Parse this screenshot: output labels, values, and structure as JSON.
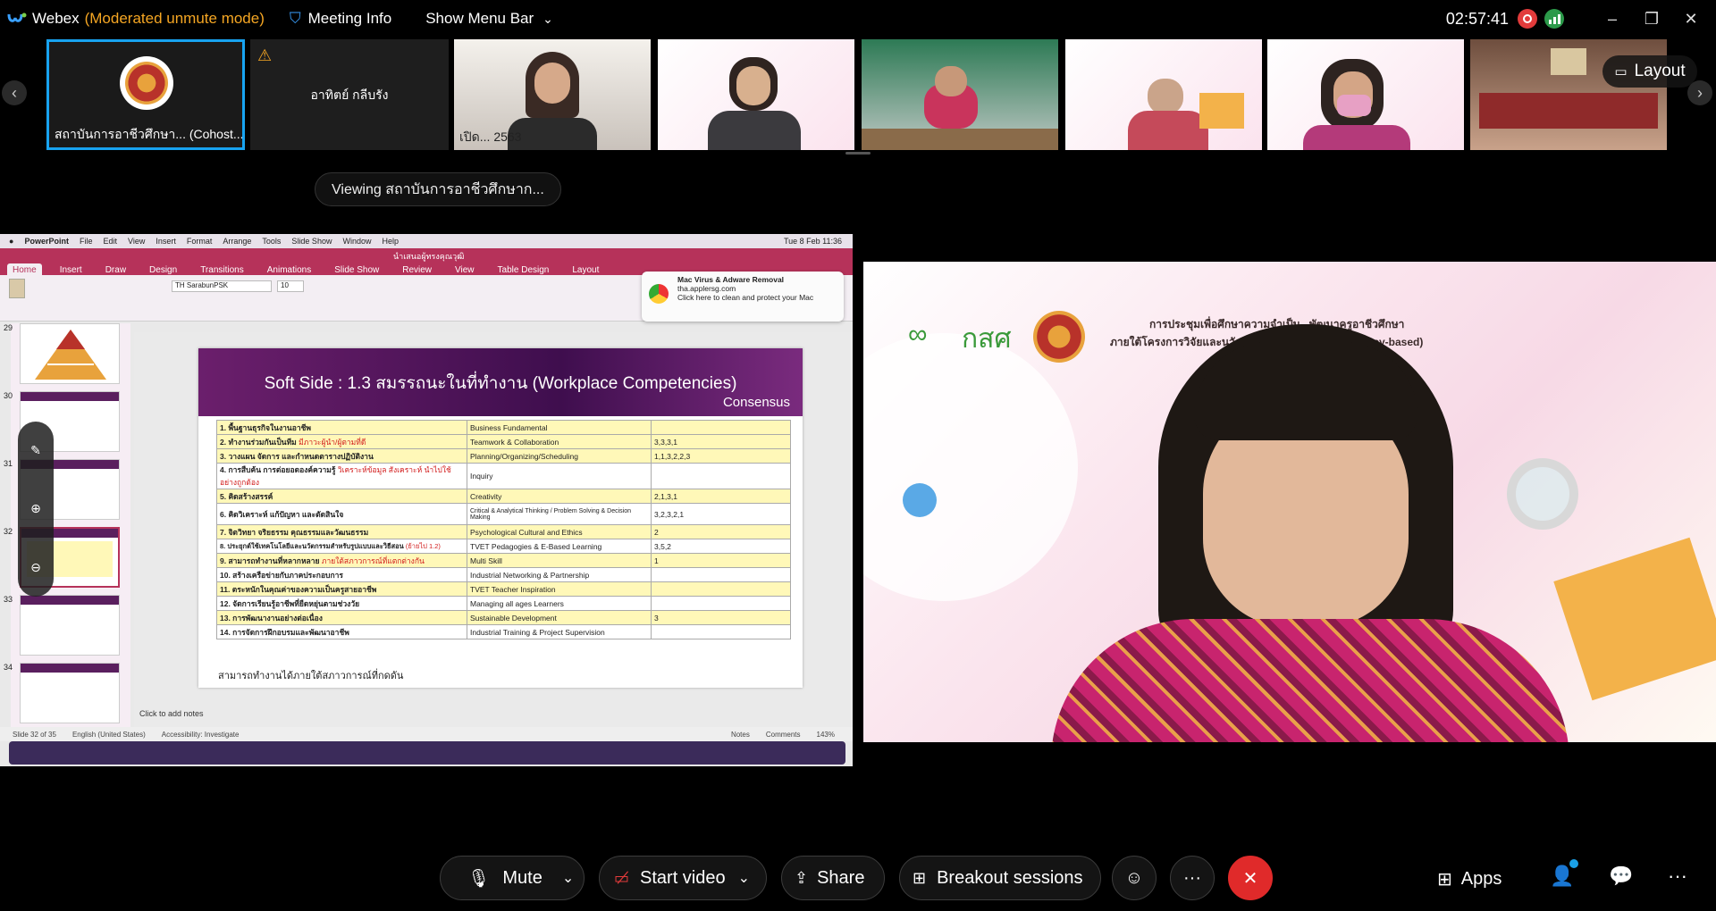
{
  "titlebar": {
    "app_name": "Webex",
    "mode": "(Moderated unmute mode)",
    "meeting_info": "Meeting Info",
    "show_menu_bar": "Show Menu Bar",
    "clock": "02:57:41"
  },
  "strip": {
    "tiles": [
      {
        "name": "สถาบันการอาชีวศึกษา... (Cohost..."
      },
      {
        "name": "อาทิตย์ กลีบรัง"
      },
      {
        "name": "เปิด... 2563"
      },
      {
        "name": ""
      },
      {
        "name": ""
      },
      {
        "name": ""
      },
      {
        "name": ""
      },
      {
        "name": ""
      }
    ],
    "layout_label": "Layout"
  },
  "viewing": "Viewing สถาบันการอาชีวศึกษาก...",
  "ppt": {
    "menu": [
      "PowerPoint",
      "File",
      "Edit",
      "View",
      "Insert",
      "Format",
      "Arrange",
      "Tools",
      "Slide Show",
      "Window",
      "Help"
    ],
    "mac_clock": "Tue 8 Feb 11:36",
    "doc_title": "นำเสนอผู้ทรงคุณวุฒิ",
    "tabs": [
      "Home",
      "Insert",
      "Draw",
      "Design",
      "Transitions",
      "Animations",
      "Slide Show",
      "Review",
      "View",
      "Table Design",
      "Layout"
    ],
    "font": "TH SarabunPSK",
    "font_size": "10",
    "popup_title": "Mac Virus & Adware Removal",
    "popup_site": "tha.applersg.com",
    "popup_body": "Click here to clean and protect your Mac",
    "slide_numbers": [
      "29",
      "30",
      "31",
      "32",
      "33",
      "34"
    ],
    "slide_title": "Soft Side : 1.3 สมรรถนะในที่ทำงาน (Workplace Competencies)",
    "consensus": "Consensus",
    "rows": [
      {
        "th": "1. พื้นฐานธุรกิจในงานอาชีพ",
        "extra": "",
        "en": "Business Fundamental",
        "val": ""
      },
      {
        "th": "2. ทำงานร่วมกันเป็นทีม",
        "extra": "มีภาวะผู้นำ/ผู้ตามที่ดี",
        "en": "Teamwork & Collaboration",
        "val": "3,3,3,1"
      },
      {
        "th": "3. วางแผน จัดการ และกำหนดตารางปฏิบัติงาน",
        "extra": "",
        "en": "Planning/Organizing/Scheduling",
        "val": "1,1,3,2,2,3"
      },
      {
        "th": "4. การสืบค้น การต่อยอดองค์ความรู้",
        "extra": "วิเคราะห์ข้อมูล สังเคราะห์ นำไปใช้อย่างถูกต้อง",
        "en": "Inquiry",
        "val": ""
      },
      {
        "th": "5. คิดสร้างสรรค์",
        "extra": "",
        "en": "Creativity",
        "val": "2,1,3,1"
      },
      {
        "th": "6. คิดวิเคราะห์ แก้ปัญหา และตัดสินใจ",
        "extra": "",
        "en": "Critical & Analytical Thinking / Problem Solving & Decision Making",
        "val": "3,2,3,2,1"
      },
      {
        "th": "7. จิตวิทยา จริยธรรม คุณธรรมและวัฒนธรรม",
        "extra": "",
        "en": "Psychological Cultural and Ethics",
        "val": "2"
      },
      {
        "th": "8. ประยุกต์ใช้เทคโนโลยีและนวัตกรรมสำหรับรูปแบบและวิธีสอน",
        "extra": "(ย้ายไป 1.2)",
        "en": "TVET Pedagogies & E-Based Learning",
        "val": "3,5,2"
      },
      {
        "th": "9. สามารถทำงานที่หลากหลาย",
        "extra": "ภายใต้สภาวการณ์ที่แตกต่างกัน",
        "en": "Multi Skill",
        "val": "1"
      },
      {
        "th": "10. สร้างเครือข่ายกับภาคประกอบการ",
        "extra": "",
        "en": "Industrial Networking & Partnership",
        "val": ""
      },
      {
        "th": "11. ตระหนักในคุณค่าของความเป็นครูสายอาชีพ",
        "extra": "",
        "en": "TVET Teacher Inspiration",
        "val": ""
      },
      {
        "th": "12. จัดการเรียนรู้อาชีพที่ยืดหยุ่นตามช่วงวัย",
        "extra": "",
        "en": "Managing all ages Learners",
        "val": ""
      },
      {
        "th": "13. การพัฒนางานอย่างต่อเนื่อง",
        "extra": "",
        "en": "Sustainable Development",
        "val": "3"
      },
      {
        "th": "14. การจัดการฝึกอบรมและพัฒนาอาชีพ",
        "extra": "",
        "en": "Industrial Training & Project Supervision",
        "val": ""
      }
    ],
    "slide_footer": "สามารถทำงานได้ภายใต้สภาวการณ์ที่กดดัน",
    "notes_hint": "Click to add notes",
    "status": {
      "slide": "Slide 32 of 35",
      "lang": "English (United States)",
      "access": "Accessibility: Investigate",
      "notes": "Notes",
      "comments": "Comments",
      "zoom": "143%"
    }
  },
  "speaker": {
    "banner_org": "กสศ",
    "banner_line1": "การประชุมเพื่อศึกษาความจำเป็น...พัฒนาครูอาชีวศึกษา",
    "banner_line2": "ภายใต้โครงการวิจัยและนวัตกรรมการผลิต... (Competency-based)"
  },
  "controls": {
    "mute": "Mute",
    "start_video": "Start video",
    "share": "Share",
    "breakout": "Breakout sessions",
    "apps": "Apps"
  },
  "colors": {
    "accent_blue": "#1aa0e6",
    "leave_red": "#e02a2a",
    "ppt_red": "#b6325a",
    "mode_orange": "#f5a623"
  }
}
